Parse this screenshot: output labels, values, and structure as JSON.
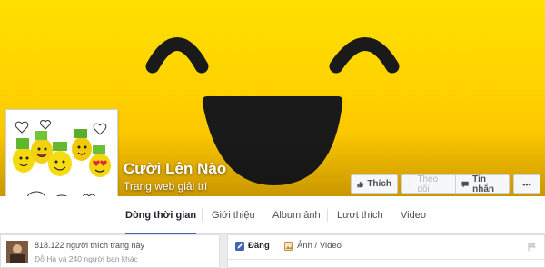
{
  "page": {
    "name": "Cười Lên Nào",
    "category": "Trang web giải trí"
  },
  "actions": {
    "like": "Thích",
    "follow": "Theo dõi",
    "message": "Tin nhắn",
    "more": "•••"
  },
  "tabs": [
    {
      "label": "Dòng thời gian",
      "active": true
    },
    {
      "label": "Giới thiệu"
    },
    {
      "label": "Album ảnh"
    },
    {
      "label": "Lượt thích"
    },
    {
      "label": "Video"
    }
  ],
  "likes_card": {
    "count_text": "818.122 người thích trang này",
    "friends_text": "Đỗ Hà và 240 người bạn khác"
  },
  "composer": {
    "post_tab": "Đăng",
    "photo_video_tab": "Ảnh / Video"
  },
  "colors": {
    "cover_yellow": "#ffd600",
    "face_dark": "#1a1a1a",
    "accent_blue": "#4267b2"
  }
}
